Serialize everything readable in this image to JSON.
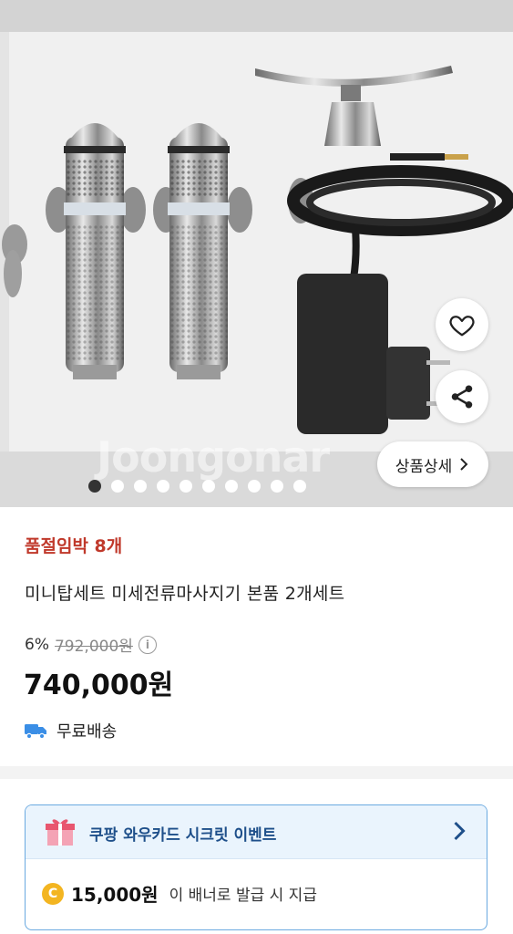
{
  "hero": {
    "watermark": "Joongonar",
    "detail_button_label": "상품상세",
    "slide_count": 10,
    "active_slide": 1
  },
  "product": {
    "badge": "품절임박 8개",
    "title": "미니탑세트 미세전류마사지기 본품 2개세트",
    "discount": "6%",
    "original_price": "792,000원",
    "price": "740,000원",
    "shipping": "무료배송"
  },
  "promo": {
    "title": "쿠팡 와우카드 시크릿 이벤트",
    "coin_symbol": "C",
    "cash_amount": "15,000원",
    "cash_desc": "이 배너로 발급 시 지급"
  },
  "colors": {
    "badge": "#c0392b",
    "promo_border": "#6aa9e0",
    "promo_head_bg": "#eaf4fd",
    "truck": "#3a8ee6",
    "coin": "#f3b521"
  },
  "icons": [
    "heart-icon",
    "share-icon",
    "chevron-right-icon",
    "info-icon",
    "truck-icon",
    "gift-icon",
    "coin-icon"
  ]
}
